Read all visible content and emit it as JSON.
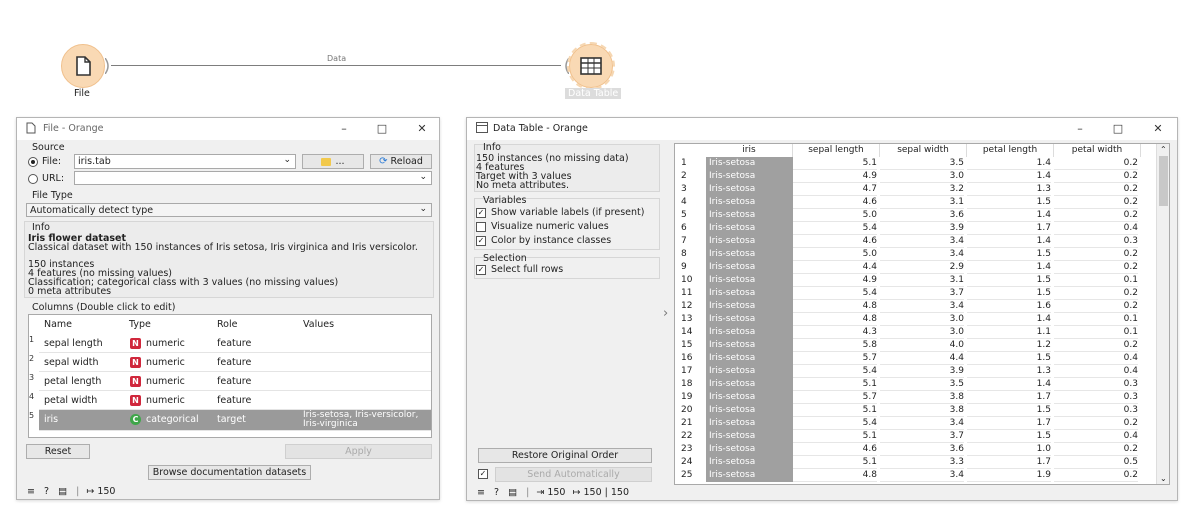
{
  "canvas": {
    "file_node_label": "File",
    "table_node_label": "Data Table",
    "link_label": "Data",
    "node_color": "#f9d9b4"
  },
  "file_window": {
    "title": "File - Orange",
    "source_title": "Source",
    "file_label": "File:",
    "file_value": "iris.tab",
    "browse_label": "...",
    "reload_label": "Reload",
    "url_label": "URL:",
    "url_value": "",
    "file_type_title": "File Type",
    "file_type_value": "Automatically detect type",
    "info_title": "Info",
    "info_heading": "Iris flower dataset",
    "info_desc": "Classical dataset with 150 instances of Iris setosa, Iris virginica and Iris versicolor.",
    "info_lines": [
      "150 instances",
      "4 features (no missing values)",
      "Classification; categorical class with 3 values (no missing values)",
      "0 meta attributes"
    ],
    "columns_title": "Columns (Double click to edit)",
    "headers": [
      "Name",
      "Type",
      "Role",
      "Values"
    ],
    "rows": [
      {
        "num": "1",
        "name": "sepal length",
        "badge": "N",
        "type": "numeric",
        "role": "feature",
        "values": ""
      },
      {
        "num": "2",
        "name": "sepal width",
        "badge": "N",
        "type": "numeric",
        "role": "feature",
        "values": ""
      },
      {
        "num": "3",
        "name": "petal length",
        "badge": "N",
        "type": "numeric",
        "role": "feature",
        "values": ""
      },
      {
        "num": "4",
        "name": "petal width",
        "badge": "N",
        "type": "numeric",
        "role": "feature",
        "values": ""
      },
      {
        "num": "5",
        "name": "iris",
        "badge": "C",
        "type": "categorical",
        "role": "target",
        "values": "Iris-setosa, Iris-versicolor, Iris-virginica"
      }
    ],
    "reset_label": "Reset",
    "apply_label": "Apply",
    "browse_docs_label": "Browse documentation datasets",
    "status_count": "150",
    "numeric_badge_color": "#d0273c",
    "categorical_badge_color": "#3fa64a"
  },
  "table_window": {
    "title": "Data Table - Orange",
    "info_title": "Info",
    "info_lines": [
      "150 instances (no missing data)",
      "4 features",
      "Target with 3 values",
      "No meta attributes."
    ],
    "variables_title": "Variables",
    "opt_show_labels": "Show variable labels (if present)",
    "opt_visualize": "Visualize numeric values",
    "opt_color": "Color by instance classes",
    "selection_title": "Selection",
    "opt_select_rows": "Select full rows",
    "restore_label": "Restore Original Order",
    "send_label": "Send Automatically",
    "status_in": "150",
    "status_out": "150 | 150",
    "headers": [
      "iris",
      "sepal length",
      "sepal width",
      "petal length",
      "petal width"
    ],
    "rows": [
      [
        "1",
        "Iris-setosa",
        "5.1",
        "3.5",
        "1.4",
        "0.2"
      ],
      [
        "2",
        "Iris-setosa",
        "4.9",
        "3.0",
        "1.4",
        "0.2"
      ],
      [
        "3",
        "Iris-setosa",
        "4.7",
        "3.2",
        "1.3",
        "0.2"
      ],
      [
        "4",
        "Iris-setosa",
        "4.6",
        "3.1",
        "1.5",
        "0.2"
      ],
      [
        "5",
        "Iris-setosa",
        "5.0",
        "3.6",
        "1.4",
        "0.2"
      ],
      [
        "6",
        "Iris-setosa",
        "5.4",
        "3.9",
        "1.7",
        "0.4"
      ],
      [
        "7",
        "Iris-setosa",
        "4.6",
        "3.4",
        "1.4",
        "0.3"
      ],
      [
        "8",
        "Iris-setosa",
        "5.0",
        "3.4",
        "1.5",
        "0.2"
      ],
      [
        "9",
        "Iris-setosa",
        "4.4",
        "2.9",
        "1.4",
        "0.2"
      ],
      [
        "10",
        "Iris-setosa",
        "4.9",
        "3.1",
        "1.5",
        "0.1"
      ],
      [
        "11",
        "Iris-setosa",
        "5.4",
        "3.7",
        "1.5",
        "0.2"
      ],
      [
        "12",
        "Iris-setosa",
        "4.8",
        "3.4",
        "1.6",
        "0.2"
      ],
      [
        "13",
        "Iris-setosa",
        "4.8",
        "3.0",
        "1.4",
        "0.1"
      ],
      [
        "14",
        "Iris-setosa",
        "4.3",
        "3.0",
        "1.1",
        "0.1"
      ],
      [
        "15",
        "Iris-setosa",
        "5.8",
        "4.0",
        "1.2",
        "0.2"
      ],
      [
        "16",
        "Iris-setosa",
        "5.7",
        "4.4",
        "1.5",
        "0.4"
      ],
      [
        "17",
        "Iris-setosa",
        "5.4",
        "3.9",
        "1.3",
        "0.4"
      ],
      [
        "18",
        "Iris-setosa",
        "5.1",
        "3.5",
        "1.4",
        "0.3"
      ],
      [
        "19",
        "Iris-setosa",
        "5.7",
        "3.8",
        "1.7",
        "0.3"
      ],
      [
        "20",
        "Iris-setosa",
        "5.1",
        "3.8",
        "1.5",
        "0.3"
      ],
      [
        "21",
        "Iris-setosa",
        "5.4",
        "3.4",
        "1.7",
        "0.2"
      ],
      [
        "22",
        "Iris-setosa",
        "5.1",
        "3.7",
        "1.5",
        "0.4"
      ],
      [
        "23",
        "Iris-setosa",
        "4.6",
        "3.6",
        "1.0",
        "0.2"
      ],
      [
        "24",
        "Iris-setosa",
        "5.1",
        "3.3",
        "1.7",
        "0.5"
      ],
      [
        "25",
        "Iris-setosa",
        "4.8",
        "3.4",
        "1.9",
        "0.2"
      ]
    ],
    "class_cell_color": "#a0a0a0"
  }
}
